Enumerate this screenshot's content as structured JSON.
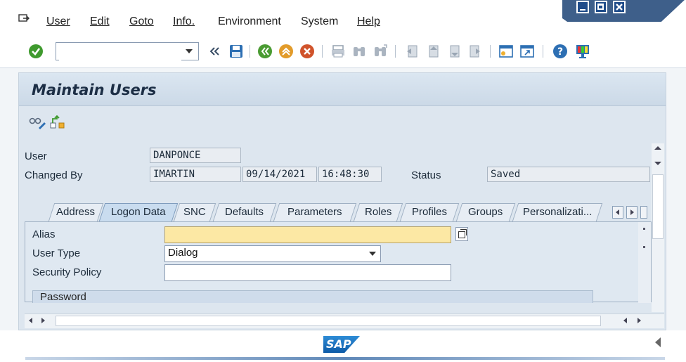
{
  "menubar": {
    "items": [
      "User",
      "Edit",
      "Goto",
      "Info.",
      "Environment",
      "System",
      "Help"
    ]
  },
  "toolbar": {
    "command_value": "",
    "icons": [
      "enter-icon",
      "back-double-arrow-icon",
      "save-icon",
      "back-icon",
      "exit-icon",
      "cancel-icon",
      "print-icon",
      "find-icon",
      "find-next-icon",
      "first-page-icon",
      "previous-page-icon",
      "next-page-icon",
      "last-page-icon",
      "create-session-icon",
      "shortcut-icon",
      "help-icon",
      "customize-layout-icon"
    ]
  },
  "screen": {
    "title": "Maintain Users",
    "app_icons": [
      "display-change-icon",
      "hierarchy-icon"
    ]
  },
  "header_fields": {
    "user_label": "User",
    "user_value": "DANPONCE",
    "changed_by_label": "Changed By",
    "changed_by_value": "IMARTIN",
    "changed_date": "09/14/2021",
    "changed_time": "16:48:30",
    "status_label": "Status",
    "status_value": "Saved"
  },
  "tabs": [
    "Address",
    "Logon Data",
    "SNC",
    "Defaults",
    "Parameters",
    "Roles",
    "Profiles",
    "Groups",
    "Personalizati..."
  ],
  "active_tab": "Logon Data",
  "logon_data": {
    "alias_label": "Alias",
    "alias_value": "",
    "user_type_label": "User Type",
    "user_type_value": "Dialog",
    "security_policy_label": "Security Policy",
    "security_policy_value": "",
    "password_section": "Password"
  },
  "statusbar": {
    "logo_text": "SAP"
  },
  "colors": {
    "required_field": "#fce8a4",
    "title_text": "#1c2e45",
    "window_controls": "#3e5f8a"
  }
}
